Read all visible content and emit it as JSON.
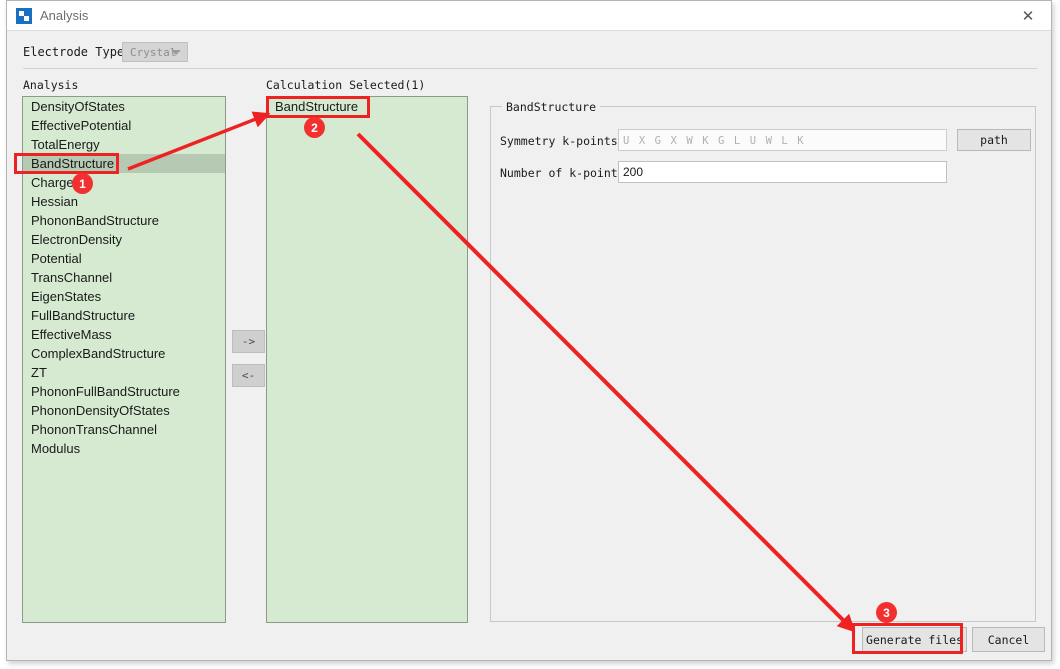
{
  "window": {
    "title": "Analysis",
    "app_icon": "app-logo-icon",
    "close_icon": "close-icon"
  },
  "toolbar": {
    "electrode_type_label": "Electrode Type",
    "electrode_type_value": "Crystal",
    "electrode_dropdown_icon": "chevron-down-icon"
  },
  "analysis_panel": {
    "caption": "Analysis",
    "items": [
      {
        "label": "DensityOfStates",
        "selected": false
      },
      {
        "label": "EffectivePotential",
        "selected": false
      },
      {
        "label": "TotalEnergy",
        "selected": false
      },
      {
        "label": "BandStructure",
        "selected": true
      },
      {
        "label": "Charge",
        "selected": false
      },
      {
        "label": "Hessian",
        "selected": false
      },
      {
        "label": "PhononBandStructure",
        "selected": false
      },
      {
        "label": "ElectronDensity",
        "selected": false
      },
      {
        "label": "Potential",
        "selected": false
      },
      {
        "label": "TransChannel",
        "selected": false
      },
      {
        "label": "EigenStates",
        "selected": false
      },
      {
        "label": "FullBandStructure",
        "selected": false
      },
      {
        "label": "EffectiveMass",
        "selected": false
      },
      {
        "label": "ComplexBandStructure",
        "selected": false
      },
      {
        "label": "ZT",
        "selected": false
      },
      {
        "label": "PhononFullBandStructure",
        "selected": false
      },
      {
        "label": "PhononDensityOfStates",
        "selected": false
      },
      {
        "label": "PhononTransChannel",
        "selected": false
      },
      {
        "label": "Modulus",
        "selected": false
      }
    ]
  },
  "transfer": {
    "add_label": "->",
    "remove_label": "<-"
  },
  "selected_panel": {
    "caption": "Calculation Selected(1)",
    "items": [
      {
        "label": "BandStructure"
      }
    ]
  },
  "settings": {
    "groupbox_title": "BandStructure",
    "symmetry_kpoints_label": "Symmetry k-points",
    "symmetry_kpoints_value": "",
    "symmetry_kpoints_placeholder": "U X G X W K G L U W L K",
    "path_button_label": "path",
    "number_kpoints_label": "Number of k-points",
    "number_kpoints_value": "200"
  },
  "footer": {
    "generate_label": "Generate files",
    "cancel_label": "Cancel"
  },
  "annotations": {
    "accent_color": "#ee2222",
    "badges": [
      {
        "number": "1"
      },
      {
        "number": "2"
      },
      {
        "number": "3"
      }
    ]
  }
}
